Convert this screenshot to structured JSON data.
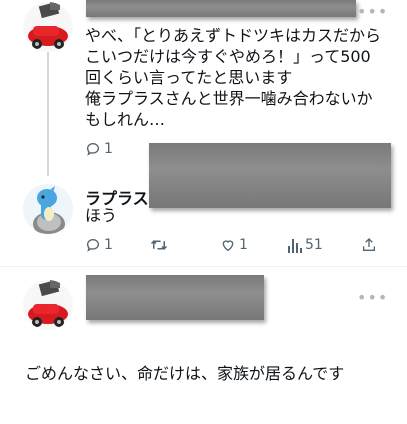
{
  "tweet1": {
    "text": "やべ、「とりあえずトドツキはカスだからこいつだけは今すぐやめろ！」って500回くらい言ってたと思います\n俺ラプラスさんと世界一噛み合わないかもしれん…",
    "reply_count": "1"
  },
  "tweet2": {
    "display_name": "ラプラス",
    "text": "ほう",
    "reply_count": "1",
    "like_count": "1",
    "view_count": "51"
  },
  "tweet3": {
    "text": "ごめんなさい、命だけは、家族が居るんです"
  },
  "icons": [
    "reply-icon",
    "retweet-icon",
    "like-icon",
    "views-icon",
    "share-icon",
    "more-icon"
  ]
}
